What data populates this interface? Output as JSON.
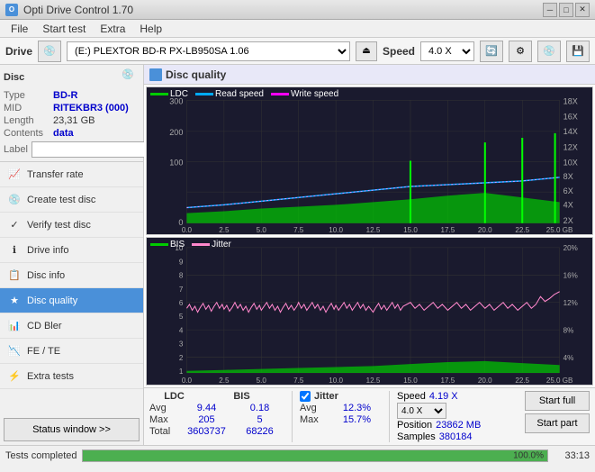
{
  "titleBar": {
    "title": "Opti Drive Control 1.70",
    "iconText": "O"
  },
  "menuBar": {
    "items": [
      "File",
      "Start test",
      "Extra",
      "Help"
    ]
  },
  "driveBar": {
    "driveLabel": "Drive",
    "driveValue": "(E:)  PLEXTOR BD-R  PX-LB950SA 1.06",
    "speedLabel": "Speed",
    "speedValue": "4.0 X"
  },
  "disc": {
    "title": "Disc",
    "typeLabel": "Type",
    "typeValue": "BD-R",
    "midLabel": "MID",
    "midValue": "RITEKBR3 (000)",
    "lengthLabel": "Length",
    "lengthValue": "23,31 GB",
    "contentsLabel": "Contents",
    "contentsValue": "data",
    "labelLabel": "Label",
    "labelValue": ""
  },
  "navItems": [
    {
      "id": "transfer-rate",
      "label": "Transfer rate",
      "icon": "📈"
    },
    {
      "id": "create-test-disc",
      "label": "Create test disc",
      "icon": "💿"
    },
    {
      "id": "verify-test-disc",
      "label": "Verify test disc",
      "icon": "✓"
    },
    {
      "id": "drive-info",
      "label": "Drive info",
      "icon": "ℹ"
    },
    {
      "id": "disc-info",
      "label": "Disc info",
      "icon": "📋"
    },
    {
      "id": "disc-quality",
      "label": "Disc quality",
      "icon": "★",
      "active": true
    },
    {
      "id": "cd-bler",
      "label": "CD Bler",
      "icon": "📊"
    },
    {
      "id": "fe-te",
      "label": "FE / TE",
      "icon": "📉"
    },
    {
      "id": "extra-tests",
      "label": "Extra tests",
      "icon": "⚡"
    }
  ],
  "statusButton": "Status window >>",
  "panel": {
    "title": "Disc quality"
  },
  "topChart": {
    "legend": [
      {
        "label": "LDC",
        "color": "#00aa00"
      },
      {
        "label": "Read speed",
        "color": "#00aaff"
      },
      {
        "label": "Write speed",
        "color": "#ff00ff"
      }
    ],
    "yAxisMax": 300,
    "yAxisLabels": [
      "300",
      "200",
      "100",
      "0"
    ],
    "yAxisRight": [
      "18X",
      "16X",
      "14X",
      "12X",
      "10X",
      "8X",
      "6X",
      "4X",
      "2X"
    ],
    "xAxisLabels": [
      "0.0",
      "2.5",
      "5.0",
      "7.5",
      "10.0",
      "12.5",
      "15.0",
      "17.5",
      "20.0",
      "22.5",
      "25.0 GB"
    ]
  },
  "bottomChart": {
    "legend": [
      {
        "label": "BIS",
        "color": "#00aa00"
      },
      {
        "label": "Jitter",
        "color": "#ff88cc"
      }
    ],
    "yAxisMax": 10,
    "yAxisLabels": [
      "10",
      "9",
      "8",
      "7",
      "6",
      "5",
      "4",
      "3",
      "2",
      "1"
    ],
    "yAxisRight": [
      "20%",
      "16%",
      "12%",
      "8%",
      "4%"
    ],
    "xAxisLabels": [
      "0.0",
      "2.5",
      "5.0",
      "7.5",
      "10.0",
      "12.5",
      "15.0",
      "17.5",
      "20.0",
      "22.5",
      "25.0 GB"
    ]
  },
  "stats": {
    "columns": {
      "ldc": "LDC",
      "bis": "BIS",
      "jitter": "Jitter",
      "speed": "Speed",
      "speedValue": "4.19 X",
      "speedSelect": "4.0 X"
    },
    "rows": [
      {
        "label": "Avg",
        "ldc": "9.44",
        "bis": "0.18",
        "jitter": "12.3%"
      },
      {
        "label": "Max",
        "ldc": "205",
        "bis": "5",
        "jitter": "15.7%"
      },
      {
        "label": "Total",
        "ldc": "3603737",
        "bis": "68226",
        "jitter": ""
      }
    ],
    "jitterChecked": true,
    "positionLabel": "Position",
    "positionValue": "23862 MB",
    "samplesLabel": "Samples",
    "samplesValue": "380184"
  },
  "buttons": {
    "startFull": "Start full",
    "startPart": "Start part"
  },
  "bottomBar": {
    "statusText": "Tests completed",
    "progressValue": 100,
    "progressText": "100.0%",
    "timeText": "33:13"
  }
}
